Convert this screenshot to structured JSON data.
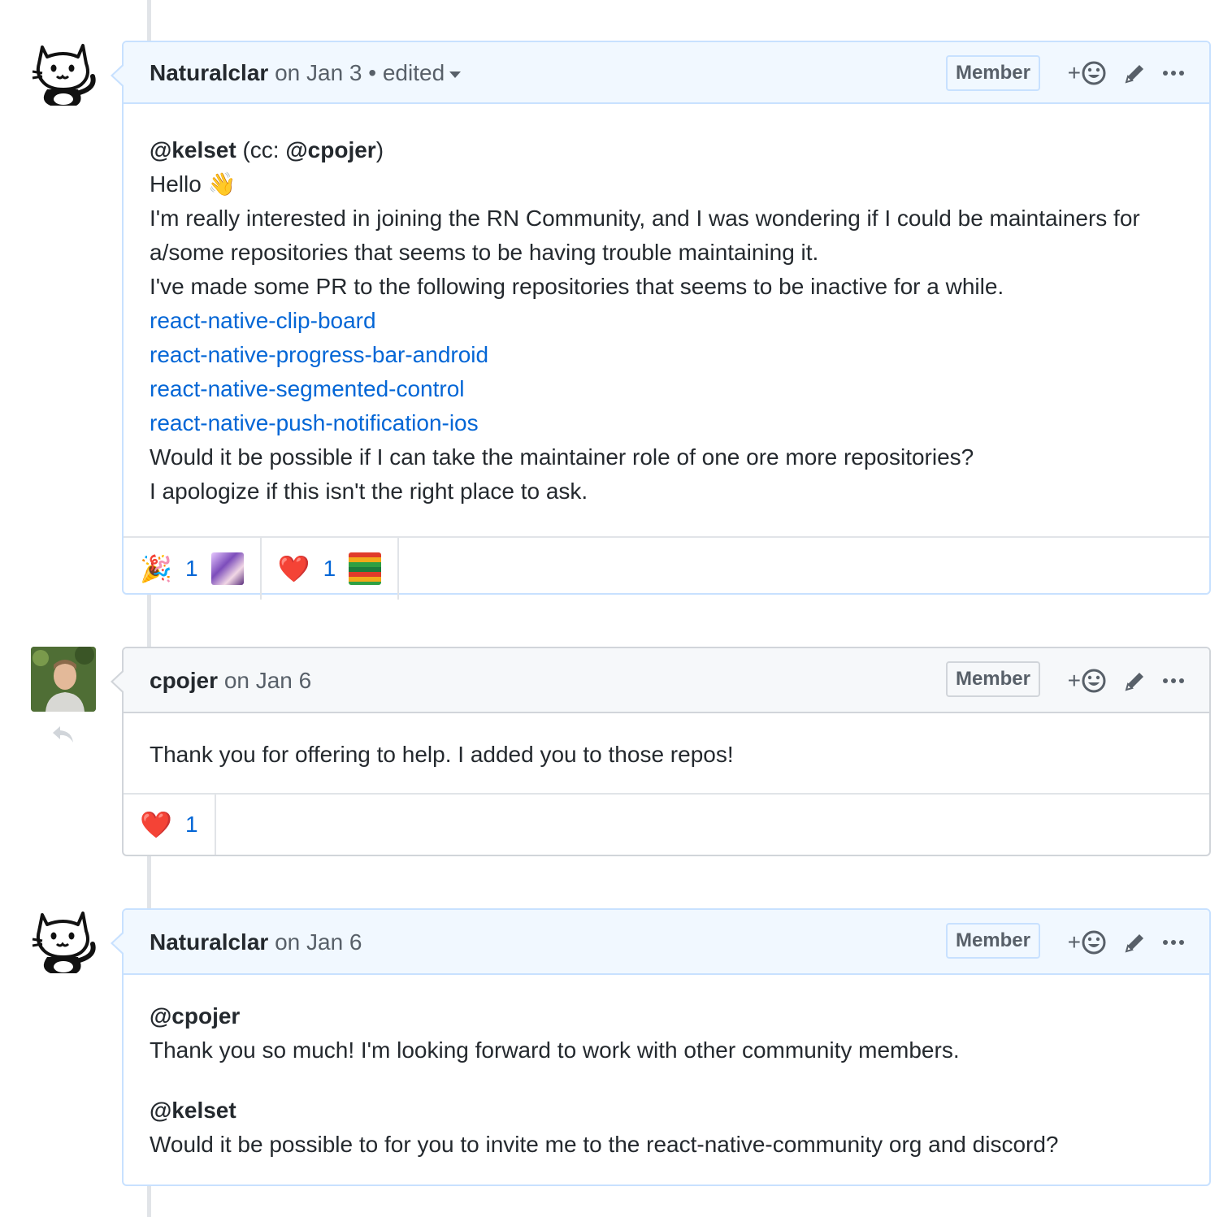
{
  "comments": [
    {
      "author": "Naturalclar",
      "date": "on Jan 3",
      "edited": "• edited",
      "badge": "Member",
      "add_reaction": "+",
      "body": {
        "line1_mention": "@kelset",
        "line1_pre": " (cc: ",
        "line1_mention2": "@cpojer",
        "line1_post": ")",
        "hello": "Hello",
        "wave": "👋",
        "p1": "I'm really interested in joining the RN Community, and I was wondering if I could be maintainers for",
        "p2": "a/some repositories that seems to be having trouble maintaining it.",
        "p3": "I've made some PR to the following repositories that seems to be inactive for a while.",
        "links": [
          "react-native-clip-board",
          "react-native-progress-bar-android",
          "react-native-segmented-control",
          "react-native-push-notification-ios"
        ],
        "p4": "Would it be possible if I can take the maintainer role of one ore more repositories?",
        "p5": "I apologize if this isn't the right place to ask."
      },
      "reactions": [
        {
          "emoji": "🎉",
          "count": "1"
        },
        {
          "emoji": "❤️",
          "count": "1"
        }
      ]
    },
    {
      "author": "cpojer",
      "date": "on Jan 6",
      "badge": "Member",
      "add_reaction": "+",
      "body": {
        "p1": "Thank you for offering to help. I added you to those repos!"
      },
      "reactions": [
        {
          "emoji": "❤️",
          "count": "1"
        }
      ]
    },
    {
      "author": "Naturalclar",
      "date": "on Jan 6",
      "badge": "Member",
      "add_reaction": "+",
      "body": {
        "m1": "@cpojer",
        "p1": "Thank you so much! I'm looking forward to work with other community members.",
        "m2": "@kelset",
        "p2": "Would it be possible to for you to invite me to the react-native-community org and discord?"
      }
    }
  ],
  "colors": {
    "link": "#0366d6",
    "self_header": "#f1f8ff",
    "other_header": "#f6f8fa"
  }
}
